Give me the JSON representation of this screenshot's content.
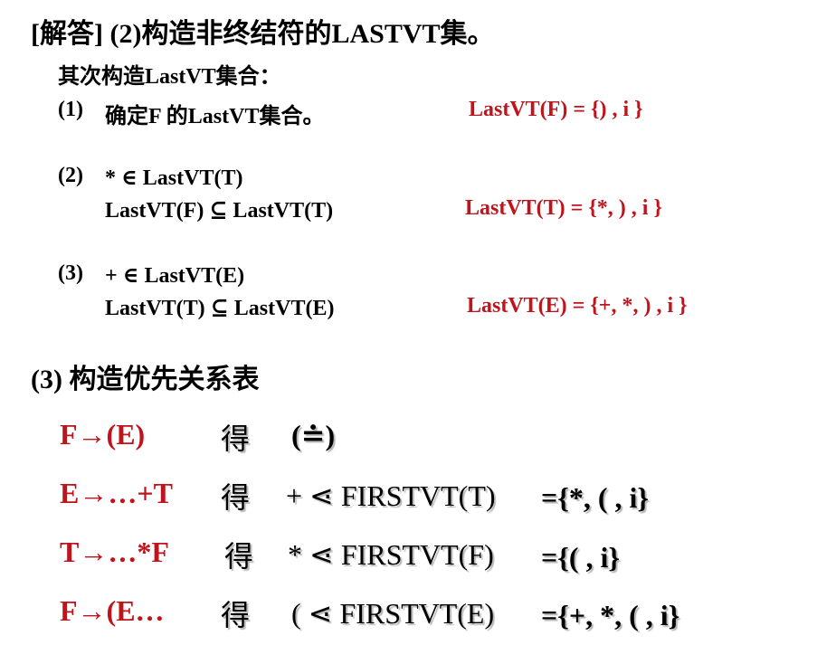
{
  "title": "[解答] (2)构造非终结符的LASTVT集。",
  "intro": "其次构造LastVT集合：",
  "steps": [
    {
      "num": "(1)",
      "lines": [
        "确定F 的LastVT集合。"
      ],
      "result": "LastVT(F)  = {) ,  i }"
    },
    {
      "num": "(2)",
      "lines": [
        "* ∈ LastVT(T)",
        "LastVT(F) ⊆ LastVT(T)"
      ],
      "result": "LastVT(T) = {*, ) , i }"
    },
    {
      "num": "(3)",
      "lines": [
        "+ ∈ LastVT(E)",
        "LastVT(T) ⊆ LastVT(E)"
      ],
      "result": "LastVT(E) = {+, *, ) , i }"
    }
  ],
  "section3": "(3) 构造优先关系表",
  "rules": [
    {
      "prod": "F→(E)",
      "de": "得",
      "rel": "(≐)",
      "set": ""
    },
    {
      "prod": "E→…+T",
      "de": "得",
      "rel": "+ ⋖ FIRSTVT(T)",
      "set": "={*, ( ,  i}"
    },
    {
      "prod": "T→…*F",
      "de": "得",
      "rel": "* ⋖ FIRSTVT(F)",
      "set": "={( ,  i}"
    },
    {
      "prod": "F→(E…",
      "de": "得",
      "rel": "( ⋖ FIRSTVT(E)",
      "set": "={+, *, ( ,  i}"
    }
  ],
  "colors": {
    "accent": "#c0141c",
    "text": "#000000"
  }
}
